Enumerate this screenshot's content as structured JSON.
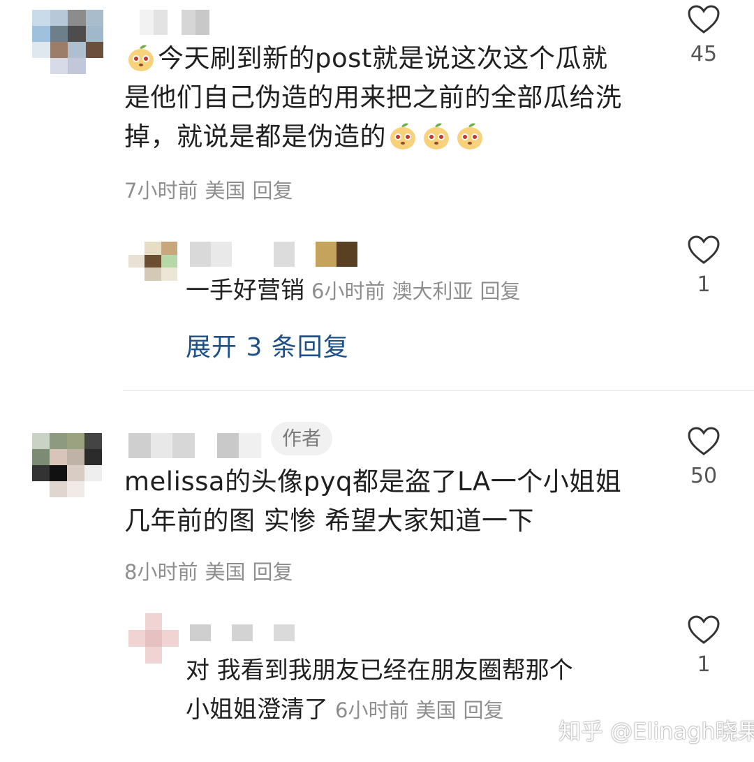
{
  "comments": [
    {
      "text_before_emoji": "今天刷到新的post就是说这次这个瓜就是他们自己伪造的用来把之前的全部瓜给洗掉，就说是都是伪造的",
      "line1": "今天刷到新的post就是说这次这个瓜就",
      "line2": "是他们自己伪造的用来把之前的全部瓜给洗",
      "line3": "掉，就说是都是伪造的",
      "time": "7小时前",
      "location": "美国",
      "reply_label": "回复",
      "likes": "45",
      "emoji": "mango-face-emoji"
    },
    {
      "reply_text": "一手好营销",
      "time": "6小时前",
      "location": "澳大利亚",
      "reply_label": "回复",
      "likes": "1",
      "expand_label": "展开 3 条回复"
    },
    {
      "badge": "作者",
      "line1": "melissa的头像pyq都是盗了LA一个小姐姐",
      "line2": "几年前的图 实惨 希望大家知道一下",
      "time": "8小时前",
      "location": "美国",
      "reply_label": "回复",
      "likes": "50"
    },
    {
      "line1": "对 我看到我朋友已经在朋友圈帮那个",
      "line2": "小姐姐澄清了",
      "time": "6小时前",
      "location": "美国",
      "reply_label": "回复",
      "likes": "1"
    }
  ],
  "watermark": "知乎 @Elinagh晓果",
  "colors": {
    "link": "#1e4f86",
    "meta": "#8e8e8e",
    "badge_bg": "#f1f1f1"
  }
}
